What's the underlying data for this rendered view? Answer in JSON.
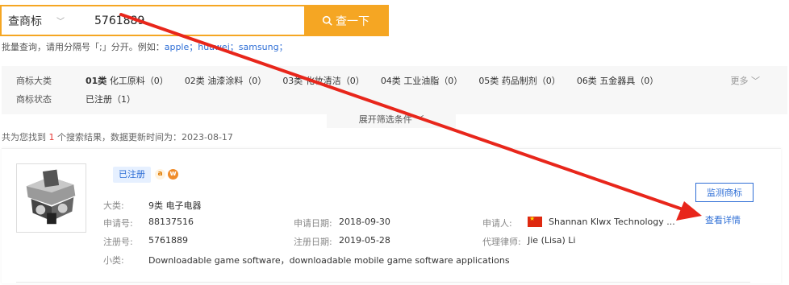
{
  "search": {
    "type_label": "查商标",
    "query": "5761889",
    "button_label": "查一下"
  },
  "batch_hint": {
    "prefix": "批量查询，请用分隔号「;」分开。例如：",
    "example": "apple；huawei；samsung；"
  },
  "filter": {
    "category_label": "商标大类",
    "categories": [
      {
        "code": "01类",
        "name": "化工原料",
        "count": "（0）"
      },
      {
        "code": "02类",
        "name": "油漆涂料",
        "count": "（0）"
      },
      {
        "code": "03类",
        "name": "化妆清洁",
        "count": "（0）"
      },
      {
        "code": "04类",
        "name": "工业油脂",
        "count": "（0）"
      },
      {
        "code": "05类",
        "name": "药品制剂",
        "count": "（0）"
      },
      {
        "code": "06类",
        "name": "五金器具",
        "count": "（0）"
      }
    ],
    "more_label": "更多",
    "status_label": "商标状态",
    "statuses": [
      {
        "name": "已注册",
        "count": "（1）"
      }
    ],
    "expand_label": "展开筛选条件"
  },
  "result": {
    "prefix": "共为您找到",
    "count": "1",
    "suffix": "个搜索结果，数据更新时间为：2023-08-17"
  },
  "card": {
    "status_badge": "已注册",
    "fields": {
      "class_label": "大类:",
      "class_value": "9类 电子电器",
      "app_no_label": "申请号:",
      "app_no_value": "88137516",
      "app_date_label": "申请日期:",
      "app_date_value": "2018-09-30",
      "applicant_label": "申请人:",
      "applicant_value": "Shannan Klwx Technology ...",
      "reg_no_label": "注册号:",
      "reg_no_value": "5761889",
      "reg_date_label": "注册日期:",
      "reg_date_value": "2019-05-28",
      "agent_label": "代理律师:",
      "agent_value": "Jie (Lisa) Li",
      "subclass_label": "小类:",
      "subclass_value": "Downloadable game software，downloadable mobile game software applications"
    },
    "monitor_button": "监测商标",
    "detail_link": "查看详情"
  },
  "colors": {
    "accent": "#f5a623",
    "link": "#2f6fd6",
    "arrow": "#e8261b"
  }
}
